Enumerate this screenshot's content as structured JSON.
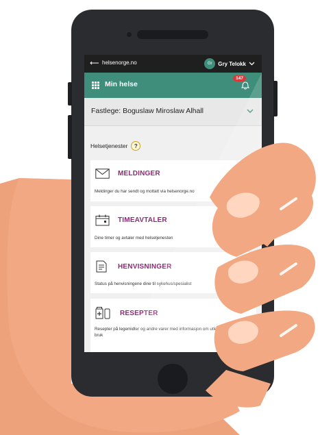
{
  "topbar": {
    "back_label": "helsenorge.no",
    "user_initials": "Gr",
    "user_name": "Gry Telokk"
  },
  "appbar": {
    "title": "Min helse",
    "notification_count": "147"
  },
  "gp": {
    "label": "Fastlege: Boguslaw Miroslaw Alhall"
  },
  "section": {
    "label": "Helsetjenester",
    "help": "?"
  },
  "cards": [
    {
      "icon": "envelope-icon",
      "title": "MELDINGER",
      "desc": "Meldinger du har sendt og mottatt via helsenorge.no"
    },
    {
      "icon": "calendar-icon",
      "title": "TIMEAVTALER",
      "desc": "Dine timer og avtaler med helsetjenesten"
    },
    {
      "icon": "document-icon",
      "title": "HENVISNINGER",
      "desc": "Status på henvisningene dine til sykehus/spesialist"
    },
    {
      "icon": "pill-bottle-icon",
      "title": "RESEPTER",
      "desc": "Resepter på legemidler og andre varer med informasjon om utleveringer og riktig bruk"
    }
  ],
  "colors": {
    "brand_green": "#3f8e7b",
    "title_purple": "#8b2c74",
    "badge_red": "#d63a3a",
    "skin": "#f2a983",
    "phone_body": "#2b2c30"
  }
}
